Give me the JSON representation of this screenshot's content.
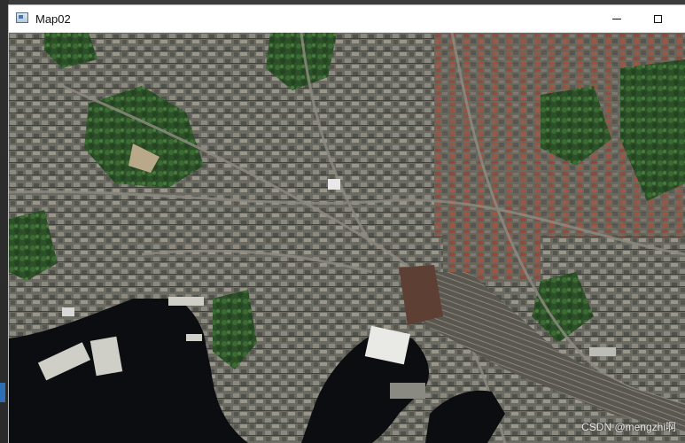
{
  "window": {
    "title": "Map02",
    "icon": "app-window-icon",
    "controls": {
      "minimize_icon": "minimize-icon",
      "maximize_icon": "maximize-icon"
    }
  },
  "map": {
    "type": "satellite imagery",
    "watermark": "CSDN @mengzhi啊"
  },
  "colors": {
    "titlebar": "#ffffff",
    "water": "#0b0d10",
    "vegetation": "#2f5a2b",
    "urban": "#6e6e66",
    "roofs_red": "#8b4a3b"
  }
}
